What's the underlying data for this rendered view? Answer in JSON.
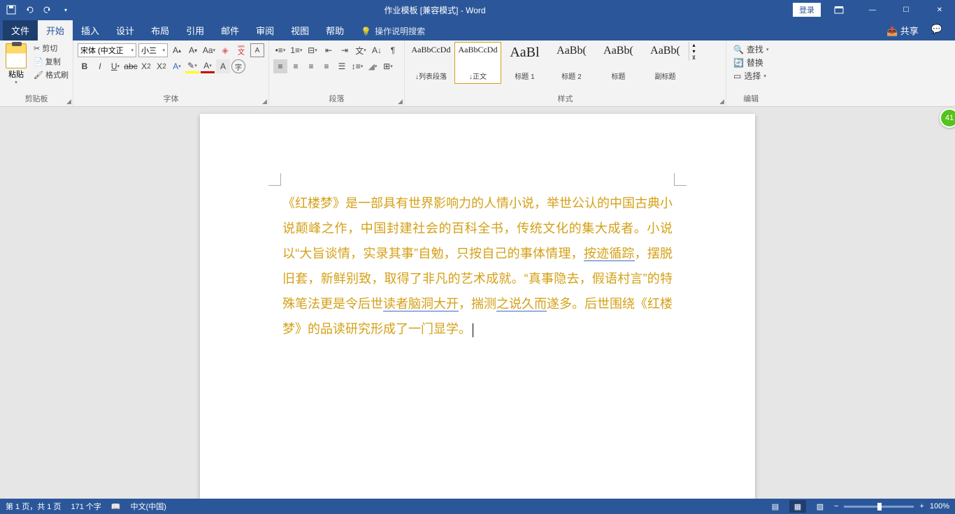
{
  "titlebar": {
    "title": "作业模板 [兼容模式] - Word",
    "login": "登录"
  },
  "tabs": {
    "file": "文件",
    "home": "开始",
    "insert": "插入",
    "design": "设计",
    "layout": "布局",
    "references": "引用",
    "mailings": "邮件",
    "review": "审阅",
    "view": "视图",
    "help": "帮助",
    "tellme": "操作说明搜索",
    "share": "共享"
  },
  "clipboard": {
    "paste": "粘贴",
    "cut": "剪切",
    "copy": "复制",
    "format_painter": "格式刷",
    "group": "剪贴板"
  },
  "font": {
    "name": "宋体 (中文正",
    "size": "小三",
    "group": "字体"
  },
  "paragraph": {
    "group": "段落"
  },
  "styles": {
    "group": "样式",
    "items": [
      {
        "preview": "AaBbCcDd",
        "label": "↓列表段落",
        "size": "12px"
      },
      {
        "preview": "AaBbCcDd",
        "label": "↓正文",
        "size": "12px"
      },
      {
        "preview": "AaBl",
        "label": "标题 1",
        "size": "20px"
      },
      {
        "preview": "AaBb(",
        "label": "标题 2",
        "size": "16px"
      },
      {
        "preview": "AaBb(",
        "label": "标题",
        "size": "16px"
      },
      {
        "preview": "AaBb(",
        "label": "副标题",
        "size": "16px"
      }
    ]
  },
  "editing": {
    "find": "查找",
    "replace": "替换",
    "select": "选择",
    "group": "编辑"
  },
  "document": {
    "p1": "《红楼梦》是一部具有世界影响力的人情小说，举世公认的中国古典小说颠峰之作，中国封建社会的百科全书，传统文化的集大成者。小说以“大旨谈情，实录其事”自勉，只按自己的事体情理，",
    "ul1": "按迹循踪",
    "p2": "，摆脱旧套，新鲜别致，取得了非凡的艺术成就。“真事隐去，假语村言”的特殊笔法更是令后世",
    "ul2": "读者脑洞大开",
    "p3": "，揣测",
    "ul3": "之说久而",
    "p4": "遂多。后世围绕《红楼梦》的品读研究形成了一门显学。"
  },
  "statusbar": {
    "page": "第 1 页，共 1 页",
    "words": "171 个字",
    "lang": "中文(中国)",
    "zoom": "100%"
  },
  "badge": "41"
}
